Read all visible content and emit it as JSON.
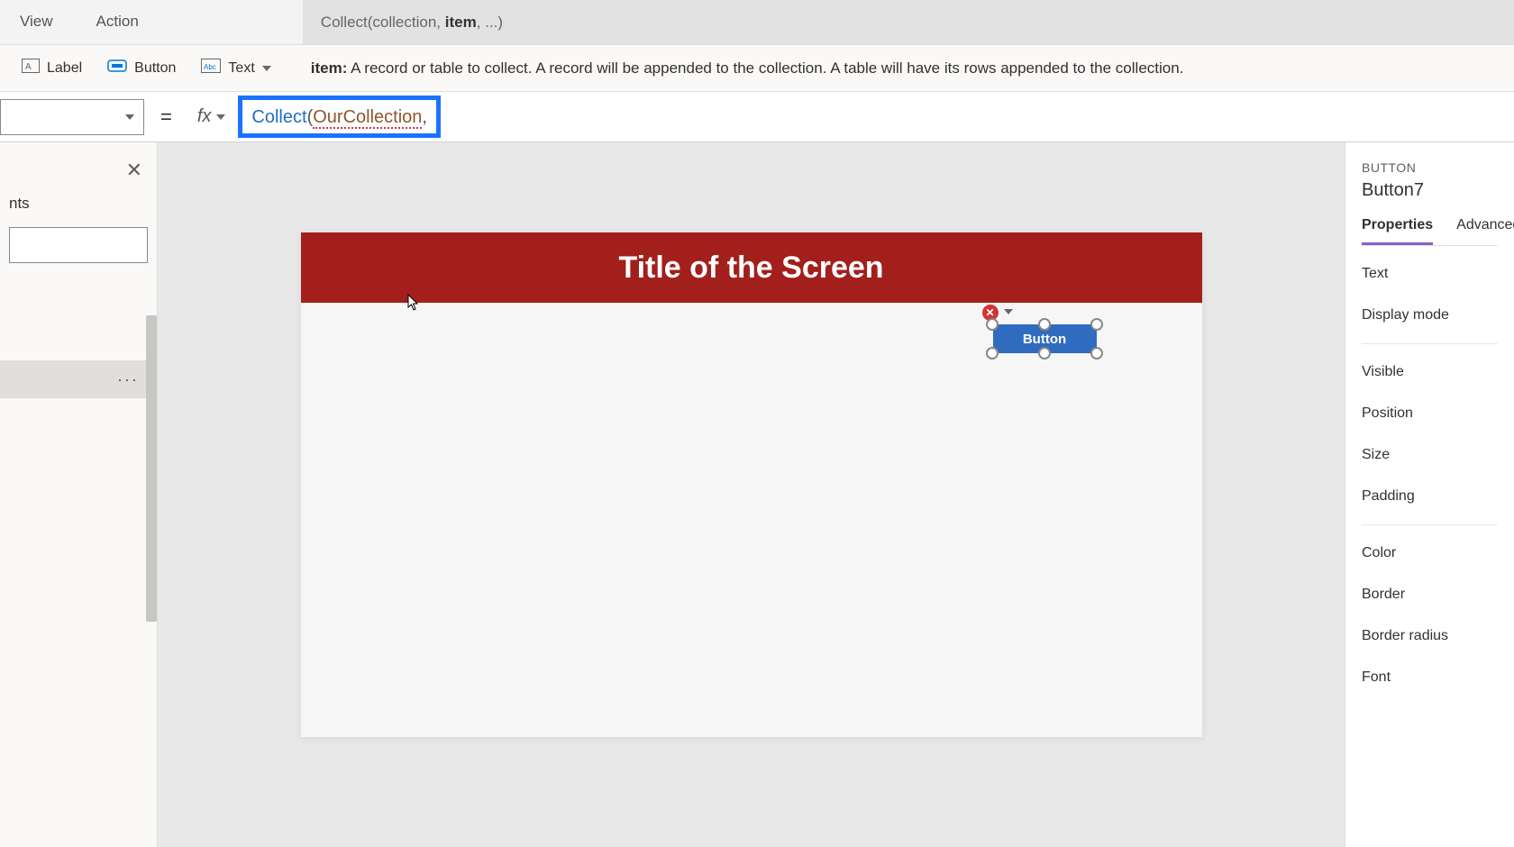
{
  "tabs": {
    "view": "View",
    "action": "Action"
  },
  "intellisense": {
    "signature_pre": "Collect(collection, ",
    "signature_bold": "item",
    "signature_post": ", ...)"
  },
  "ribbon": {
    "label": "Label",
    "button": "Button",
    "text": "Text"
  },
  "param_help": {
    "name": "item:",
    "desc": " A record or table to collect. A record will be appended to the collection. A table will have its rows appended to the collection."
  },
  "formula_bar": {
    "equals": "=",
    "fx": "fx",
    "fn": "Collect",
    "open": "(",
    "arg1": "OurCollection",
    "comma": ","
  },
  "tree": {
    "heading_suffix": "nts",
    "ellipsis": "···"
  },
  "close_icon": "✕",
  "canvas": {
    "title": "Title of the Screen",
    "button_label": "Button",
    "error_glyph": "✕"
  },
  "props": {
    "caption": "BUTTON",
    "name": "Button7",
    "tabs": {
      "properties": "Properties",
      "advanced": "Advanced"
    },
    "rows": [
      "Text",
      "Display mode",
      "Visible",
      "Position",
      "Size",
      "Padding",
      "Color",
      "Border",
      "Border radius",
      "Font"
    ]
  }
}
